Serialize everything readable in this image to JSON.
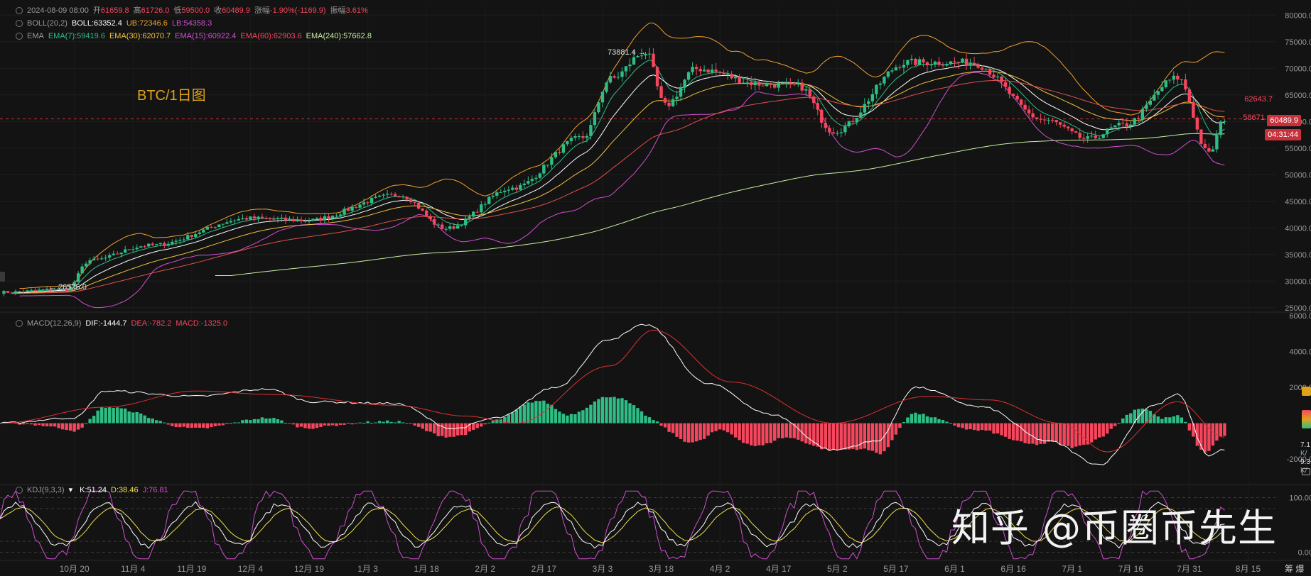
{
  "header": {
    "date": "2024-08-09 08:00",
    "open_label": "开",
    "open": "61659.8",
    "high_label": "高",
    "high": "61726.0",
    "low_label": "低",
    "low": "59500.0",
    "close_label": "收",
    "close": "60489.9",
    "change_label": "涨幅",
    "change": "-1.90%(-1169.9)",
    "amp_label": "振幅",
    "amp": "3.61%"
  },
  "boll": {
    "name": "BOLL(20,2)",
    "boll": "BOLL:63352.4",
    "ub": "UB:72346.6",
    "lb": "LB:54358.3"
  },
  "ema": {
    "name": "EMA",
    "e7": "EMA(7):59419.6",
    "e30": "EMA(30):62070.7",
    "e15": "EMA(15):60922.4",
    "e60": "EMA(60):62903.6",
    "e240": "EMA(240):57662.8"
  },
  "macd": {
    "name": "MACD(12,26,9)",
    "dif": "DIF:-1444.7",
    "dea": "DEA:-782.2",
    "macd": "MACD:-1325.0"
  },
  "kdj": {
    "name": "KDJ(9,3,3)",
    "k": "K:51.24",
    "d": "D:38.46",
    "j": "J:76.81"
  },
  "title_label": "BTC/1日图",
  "watermark": "知乎 @币圈币先生",
  "price_tags": {
    "upper": "62643.7",
    "mid": "58671.4",
    "current": "60489.9",
    "countdown": "04:31:44"
  },
  "annotations": {
    "high": "73881.4",
    "low": "26525.0"
  },
  "side_labels": {
    "a": "7.1",
    "b": "9.3",
    "k1": "K/",
    "k2": "K/"
  },
  "corner_label": "筹 爆",
  "colors": {
    "up": "#2ebd85",
    "down": "#f6465d",
    "bg": "#131313",
    "boll_upper": "#f0a030",
    "boll_lower": "#d04fd0",
    "ema240": "#c8f0a0",
    "dif": "#ffffff",
    "dea": "#e03030"
  },
  "chart_data": [
    {
      "type": "candlestick",
      "title": "BTC/1日图",
      "x_ticks": [
        "10月 20",
        "11月 4",
        "11月 19",
        "12月 4",
        "12月 19",
        "1月 3",
        "1月 18",
        "2月 2",
        "2月 17",
        "3月 3",
        "3月 18",
        "4月 2",
        "4月 17",
        "5月 2",
        "5月 17",
        "6月 1",
        "6月 16",
        "7月 1",
        "7月 16",
        "7月 31",
        "8月 15"
      ],
      "y_ticks": [
        25000,
        30000,
        35000,
        40000,
        45000,
        50000,
        55000,
        60000,
        65000,
        70000,
        75000,
        80000
      ],
      "ylim": [
        23500,
        81500
      ],
      "x_range": [
        "2023-10-01",
        "2024-08-22"
      ],
      "close_keypoints": {
        "dates": [
          "2023-10-01",
          "2023-10-18",
          "2023-10-24",
          "2023-11-08",
          "2023-12-04",
          "2023-12-18",
          "2024-01-11",
          "2024-01-23",
          "2024-02-09",
          "2024-02-27",
          "2024-03-05",
          "2024-03-14",
          "2024-03-19",
          "2024-03-27",
          "2024-04-13",
          "2024-04-22",
          "2024-05-01",
          "2024-05-20",
          "2024-06-05",
          "2024-06-24",
          "2024-07-05",
          "2024-07-14",
          "2024-07-28",
          "2024-08-05",
          "2024-08-09"
        ],
        "values": [
          27900,
          28500,
          33900,
          36700,
          41800,
          41400,
          46200,
          39900,
          47500,
          57000,
          68000,
          73000,
          63000,
          69900,
          67000,
          66700,
          58200,
          71100,
          71100,
          60300,
          56700,
          59300,
          68200,
          54000,
          60490
        ]
      },
      "annotations": {
        "high": 73881.4,
        "low": 26525.0
      }
    },
    {
      "type": "bar",
      "title": "MACD(12,26,9)",
      "y_ticks": [
        -2000,
        0,
        2000,
        4000,
        6000
      ],
      "ylim": [
        -3300,
        6200
      ],
      "dif_keypoints": {
        "dates": [
          "2023-10-01",
          "2023-10-20",
          "2023-10-28",
          "2023-11-20",
          "2023-12-08",
          "2023-12-20",
          "2024-01-10",
          "2024-01-25",
          "2024-02-05",
          "2024-02-20",
          "2024-03-05",
          "2024-03-14",
          "2024-03-30",
          "2024-04-15",
          "2024-05-01",
          "2024-05-12",
          "2024-05-22",
          "2024-06-08",
          "2024-06-25",
          "2024-07-08",
          "2024-07-22",
          "2024-07-28",
          "2024-08-05",
          "2024-08-09"
        ],
        "values": [
          0,
          300,
          1800,
          1500,
          1900,
          1200,
          1100,
          -300,
          300,
          2000,
          4700,
          5500,
          2200,
          500,
          -1500,
          -1000,
          2000,
          900,
          -1000,
          -2300,
          1000,
          1600,
          -1800,
          -1445
        ]
      },
      "dea_keypoints": {
        "dates": [
          "2023-10-01",
          "2023-10-28",
          "2023-11-20",
          "2023-12-10",
          "2024-01-10",
          "2024-01-28",
          "2024-02-10",
          "2024-03-05",
          "2024-03-16",
          "2024-04-05",
          "2024-05-01",
          "2024-05-25",
          "2024-06-10",
          "2024-06-28",
          "2024-07-10",
          "2024-07-28",
          "2024-08-09"
        ],
        "values": [
          0,
          900,
          1800,
          1600,
          1000,
          400,
          0,
          3200,
          5200,
          2300,
          0,
          1500,
          1300,
          0,
          -1600,
          1200,
          -782
        ]
      }
    },
    {
      "type": "line",
      "title": "KDJ(9,3,3)",
      "y_ticks": [
        0.0,
        100.0
      ],
      "ylim": [
        -15,
        115
      ],
      "series": [
        {
          "name": "K",
          "last": 51.24
        },
        {
          "name": "D",
          "last": 38.46
        },
        {
          "name": "J",
          "last": 76.81
        }
      ]
    }
  ]
}
